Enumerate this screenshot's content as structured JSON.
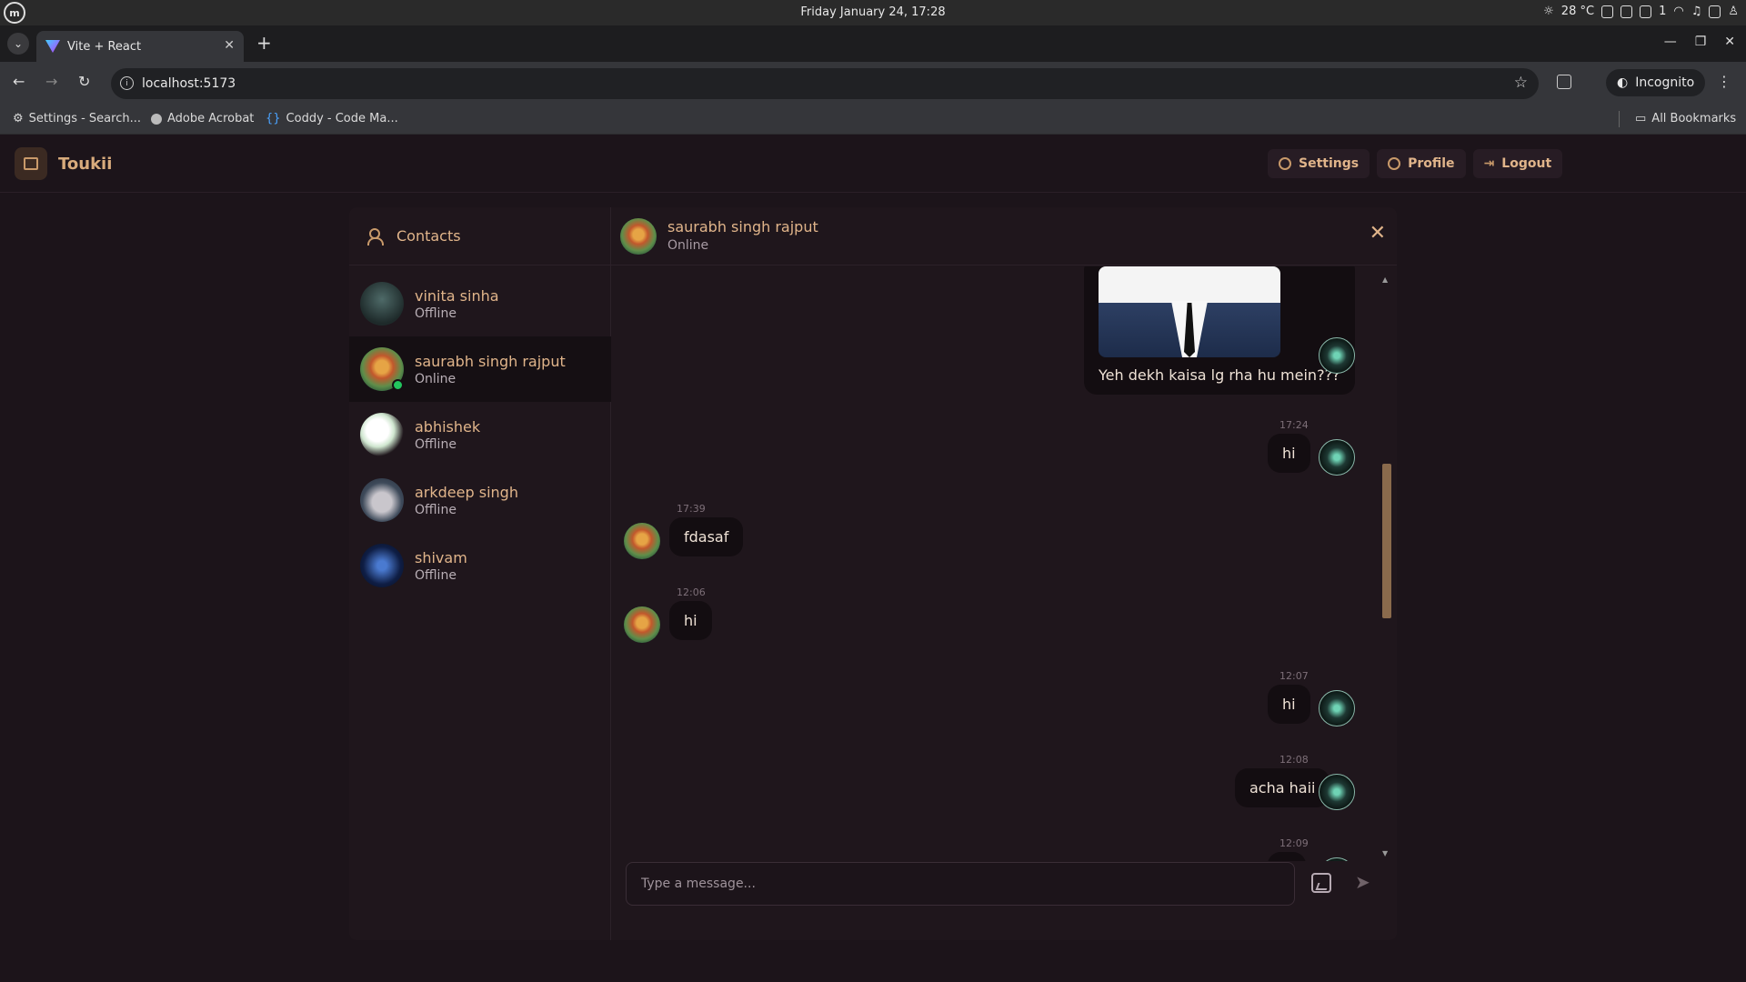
{
  "os": {
    "clock": "Friday January 24, 17:28",
    "temperature": "28 °C",
    "notification_count": "1"
  },
  "browser": {
    "tab_title": "Vite + React",
    "url": "localhost:5173",
    "incognito_label": "Incognito",
    "bookmarks": [
      "Settings - Search...",
      "Adobe Acrobat",
      "Coddy - Code Ma..."
    ],
    "all_bookmarks": "All Bookmarks"
  },
  "app": {
    "brand": "Toukii",
    "nav": {
      "settings": "Settings",
      "profile": "Profile",
      "logout": "Logout"
    },
    "contacts_title": "Contacts",
    "contacts": [
      {
        "name": "vinita sinha",
        "status": "Offline"
      },
      {
        "name": "saurabh singh rajput",
        "status": "Online"
      },
      {
        "name": "abhishek",
        "status": "Offline"
      },
      {
        "name": "arkdeep singh",
        "status": "Offline"
      },
      {
        "name": "shivam",
        "status": "Offline"
      }
    ],
    "chat": {
      "name": "saurabh singh rajput",
      "status": "Online",
      "messages": [
        {
          "from": "me",
          "text": "Yeh dekh kaisa lg rha hu mein???",
          "has_image": true
        },
        {
          "from": "me",
          "time": "17:24",
          "text": "hi"
        },
        {
          "from": "them",
          "time": "17:39",
          "text": "fdasaf"
        },
        {
          "from": "them",
          "time": "12:06",
          "text": "hi"
        },
        {
          "from": "me",
          "time": "12:07",
          "text": "hi"
        },
        {
          "from": "me",
          "time": "12:08",
          "text": "acha haii"
        },
        {
          "from": "me",
          "time": "12:09",
          "text": ""
        }
      ]
    },
    "composer": {
      "placeholder": "Type a message..."
    }
  }
}
